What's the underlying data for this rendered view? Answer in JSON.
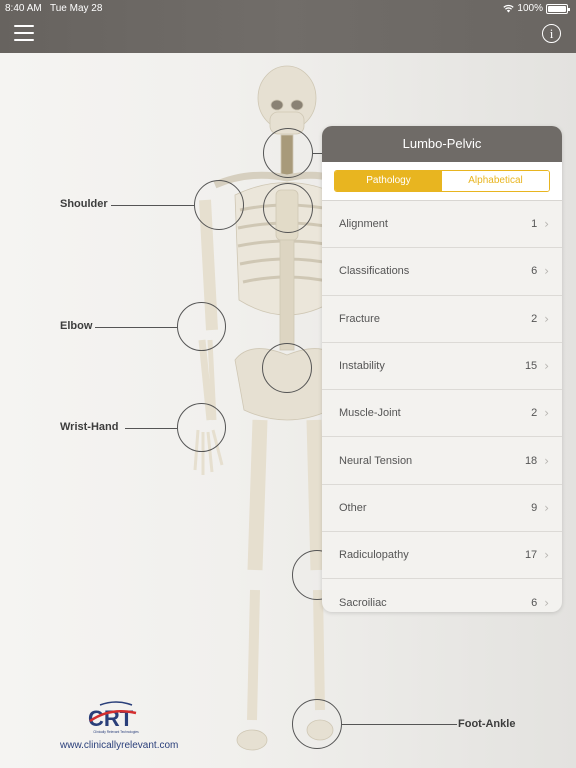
{
  "status_bar": {
    "time": "8:40 AM",
    "date": "Tue May 28",
    "battery": "100%",
    "wifi_icon": "wifi-icon",
    "battery_level": 1.0
  },
  "nav": {
    "menu_icon": "hamburger-menu-icon",
    "info_icon": "info-icon",
    "info_glyph": "i"
  },
  "regions": [
    {
      "label": "Shoulder"
    },
    {
      "label": "Elbow"
    },
    {
      "label": "Wrist-Hand"
    },
    {
      "label": "Foot-Ankle"
    }
  ],
  "panel": {
    "title": "Lumbo-Pelvic",
    "tabs": [
      {
        "label": "Pathology",
        "active": true
      },
      {
        "label": "Alphabetical",
        "active": false
      }
    ],
    "items": [
      {
        "label": "Alignment",
        "count": "1"
      },
      {
        "label": "Classifications",
        "count": "6"
      },
      {
        "label": "Fracture",
        "count": "2"
      },
      {
        "label": "Instability",
        "count": "15"
      },
      {
        "label": "Muscle-Joint",
        "count": "2"
      },
      {
        "label": "Neural Tension",
        "count": "18"
      },
      {
        "label": "Other",
        "count": "9"
      },
      {
        "label": "Radiculopathy",
        "count": "17"
      },
      {
        "label": "Sacroiliac",
        "count": "6"
      }
    ],
    "chevron": "›"
  },
  "footer": {
    "logo_text": "CRT",
    "logo_subtext": "Clinically Relevant Technologies",
    "website": "www.clinicallyrelevant.com"
  },
  "colors": {
    "accent": "#e8b520",
    "header": "#6f6b67",
    "logo_blue": "#2a3f7a",
    "logo_red": "#d32f2f"
  }
}
